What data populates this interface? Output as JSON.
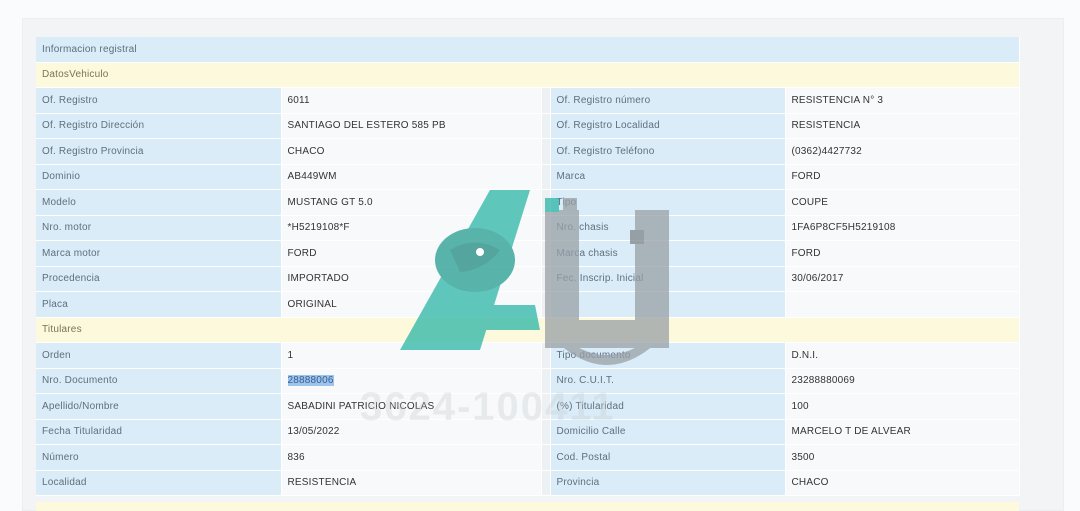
{
  "header": {
    "title": "Informacion registral"
  },
  "sections": {
    "vehiculo": "DatosVehiculo",
    "titulares": "Titulares"
  },
  "vehiculo_rows": [
    {
      "l1": "Of. Registro",
      "v1": "6011",
      "l2": "Of. Registro número",
      "v2": "RESISTENCIA N° 3"
    },
    {
      "l1": "Of. Registro Dirección",
      "v1": "SANTIAGO DEL ESTERO 585 PB",
      "l2": "Of. Registro Localidad",
      "v2": "RESISTENCIA"
    },
    {
      "l1": "Of. Registro Provincia",
      "v1": "CHACO",
      "l2": "Of. Registro Teléfono",
      "v2": "(0362)4427732"
    },
    {
      "l1": "Dominio",
      "v1": "AB449WM",
      "l2": "Marca",
      "v2": "FORD"
    },
    {
      "l1": "Modelo",
      "v1": "MUSTANG GT 5.0",
      "l2": "Tipo",
      "v2": "COUPE"
    },
    {
      "l1": "Nro. motor",
      "v1": "*H5219108*F",
      "l2": "Nro. chasis",
      "v2": "1FA6P8CF5H5219108"
    },
    {
      "l1": "Marca motor",
      "v1": "FORD",
      "l2": "Marca chasis",
      "v2": "FORD"
    },
    {
      "l1": "Procedencia",
      "v1": "IMPORTADO",
      "l2": "Fec. Inscrip. Inicial",
      "v2": "30/06/2017"
    },
    {
      "l1": "Placa",
      "v1": "ORIGINAL",
      "l2": "",
      "v2": ""
    }
  ],
  "titulares_rows": [
    {
      "l1": "Orden",
      "v1": "1",
      "l2": "Tipo documento",
      "v2": "D.N.I."
    },
    {
      "l1": "Nro. Documento",
      "v1": "28888006",
      "l2": "Nro. C.U.I.T.",
      "v2": "23288880069"
    },
    {
      "l1": "Apellido/Nombre",
      "v1": "SABADINI PATRICIO NICOLAS",
      "l2": "(%) Titularidad",
      "v2": "100"
    },
    {
      "l1": "Fecha Titularidad",
      "v1": "13/05/2022",
      "l2": "Domicilio Calle",
      "v2": "MARCELO T DE ALVEAR"
    },
    {
      "l1": "Número",
      "v1": "836",
      "l2": "Cod. Postal",
      "v2": "3500"
    },
    {
      "l1": "Localidad",
      "v1": "RESISTENCIA",
      "l2": "Provincia",
      "v2": "CHACO"
    }
  ],
  "watermark": {
    "text": "3624-100411",
    "icon": "eagle-au-logo",
    "colors": {
      "teal": "#2bb5a6",
      "gray": "#9aa0a6"
    }
  },
  "colors": {
    "label_bg": "#d9ecf7",
    "section_bg": "#fdf9dc",
    "value_bg": "#f7f9fb",
    "highlight": "#9cc4ee"
  }
}
